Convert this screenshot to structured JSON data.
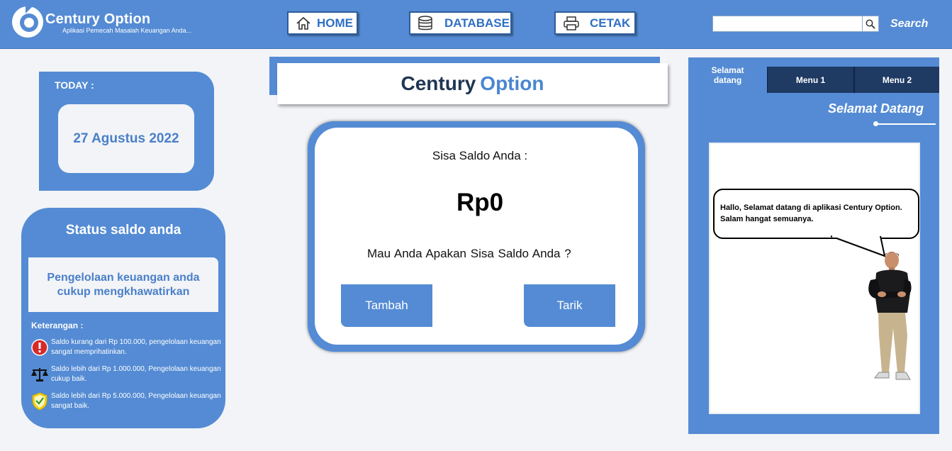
{
  "header": {
    "logo_title": "Century Option",
    "logo_subtitle": "Aplikasi Pemecah Masalah Keuangan Anda...",
    "nav": [
      {
        "label": "HOME",
        "icon": "home-icon"
      },
      {
        "label": "DATABASE",
        "icon": "database-icon"
      },
      {
        "label": "CETAK",
        "icon": "printer-icon"
      }
    ],
    "search": {
      "value": "",
      "placeholder": "",
      "label": "Search",
      "icon": "magnifier-icon"
    }
  },
  "today": {
    "label": "TODAY :",
    "date": "27 Agustus 2022"
  },
  "status": {
    "title": "Status saldo anda",
    "message": "Pengelolaan keuangan anda cukup mengkhawatirkan",
    "keterangan_title": "Keterangan :",
    "items": [
      {
        "icon": "warning-icon",
        "text": "Saldo kurang dari Rp 100.000, pengelolaan keuangan sangat memprihatinkan."
      },
      {
        "icon": "scale-icon",
        "text": "Saldo lebih dari Rp 1.000.000,  Pengelolaan keuangan cukup baik."
      },
      {
        "icon": "shield-check-icon",
        "text": "Saldo lebih dari Rp 5.000.000,  Pengelolaan keuangan sangat baik."
      }
    ]
  },
  "main": {
    "title_part1": "Century",
    "title_part2": "Option",
    "saldo_label": "Sisa Saldo Anda :",
    "saldo_amount": "Rp0",
    "question": "Mau Anda Apakan Sisa Saldo Anda ?",
    "btn_tambah": "Tambah",
    "btn_tarik": "Tarik"
  },
  "right": {
    "tabs": [
      "Selamat datang",
      "Menu 1",
      "Menu 2"
    ],
    "heading": "Selamat Datang",
    "bubble_text": "Hallo, Selamat datang di aplikasi Century Option. Salam hangat semuanya."
  },
  "colors": {
    "primary": "#548bd4",
    "dark": "#1f3a63",
    "accent_text": "#4a7fc9",
    "background": "#f2f4f7"
  }
}
